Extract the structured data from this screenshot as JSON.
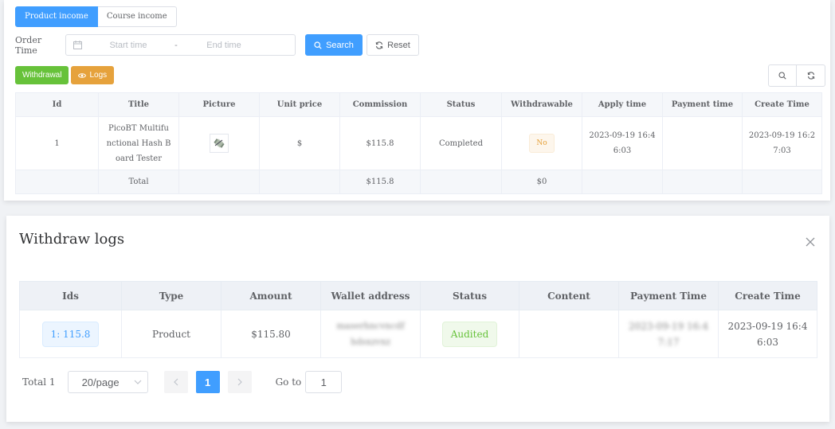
{
  "tabs": [
    "Product income",
    "Course income"
  ],
  "search": {
    "label": "Order Time",
    "start_placeholder": "Start time",
    "separator": "-",
    "end_placeholder": "End time",
    "search_btn": "Search",
    "reset_btn": "Reset"
  },
  "ops": {
    "withdrawal": "Withdrawal",
    "logs": "Logs"
  },
  "income_table": {
    "headers": [
      "Id",
      "Title",
      "Picture",
      "Unit price",
      "Commission",
      "Status",
      "Withdrawable",
      "Apply time",
      "Payment time",
      "Create Time"
    ],
    "row": {
      "id": "1",
      "title": "PicoBT Multifunctional Hash Board Tester",
      "unit_price": "$",
      "commission": "$115.8",
      "status": "Completed",
      "withdrawable": "No",
      "apply_time": "2023-09-19 16:46:03",
      "payment_time": "",
      "create_time": "2023-09-19 16:27:03"
    },
    "total_row": {
      "label": "Total",
      "commission": "$115.8",
      "withdrawable": "$0"
    }
  },
  "dialog": {
    "title": "Withdraw logs",
    "headers": [
      "Ids",
      "Type",
      "Amount",
      "Wallet address",
      "Status",
      "Content",
      "Payment Time",
      "Create Time"
    ],
    "row": {
      "ids": "1: 115.8",
      "type": "Product",
      "amount": "$115.80",
      "wallet": "maserhncvncdfhdsxzvxz",
      "status": "Audited",
      "content": "",
      "payment_time": "2023-09-19 16:47:17",
      "create_time": "2023-09-19 16:46:03"
    },
    "pagination": {
      "total": "Total 1",
      "page_size": "20/page",
      "current_page": "1",
      "goto_label": "Go to",
      "goto_value": "1"
    }
  },
  "colors": {
    "primary": "#409eff",
    "success": "#67c23a",
    "warning": "#e6a23c"
  }
}
